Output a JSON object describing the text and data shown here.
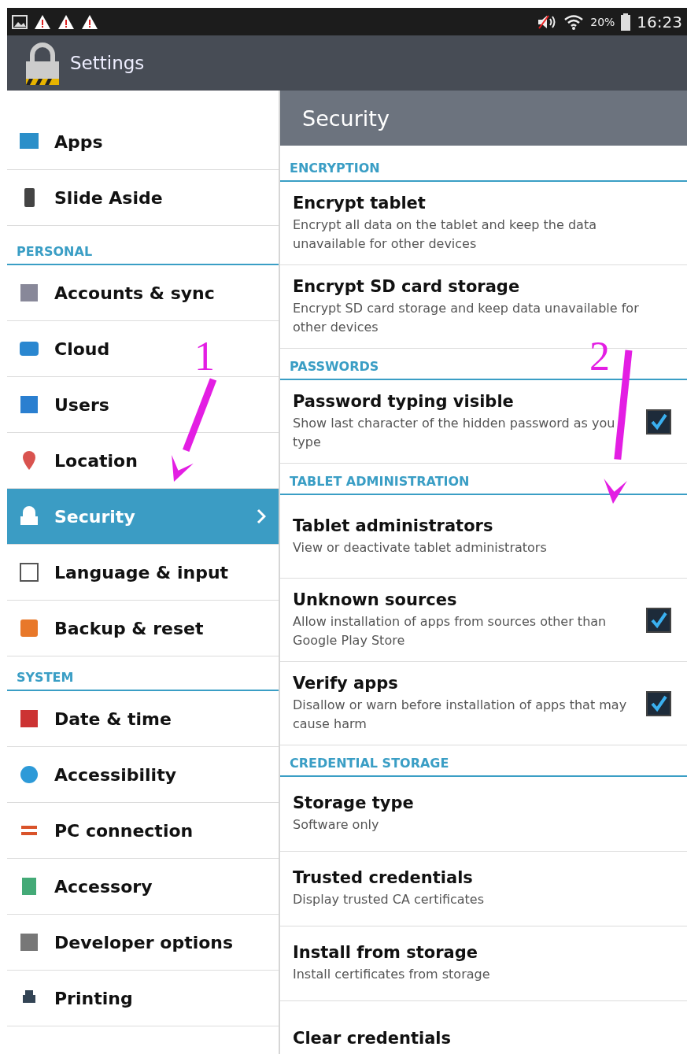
{
  "status_bar": {
    "battery": "20%",
    "time": "16:23"
  },
  "action_bar": {
    "title": "Settings"
  },
  "sidebar": {
    "groups": [
      {
        "items": [
          {
            "label": "Apps",
            "selected": false
          },
          {
            "label": "Slide Aside",
            "selected": false
          }
        ]
      },
      {
        "header": "PERSONAL",
        "items": [
          {
            "label": "Accounts & sync",
            "selected": false
          },
          {
            "label": "Cloud",
            "selected": false
          },
          {
            "label": "Users",
            "selected": false
          },
          {
            "label": "Location",
            "selected": false
          },
          {
            "label": "Security",
            "selected": true
          },
          {
            "label": "Language & input",
            "selected": false
          },
          {
            "label": "Backup & reset",
            "selected": false
          }
        ]
      },
      {
        "header": "SYSTEM",
        "items": [
          {
            "label": "Date & time",
            "selected": false
          },
          {
            "label": "Accessibility",
            "selected": false
          },
          {
            "label": "PC connection",
            "selected": false
          },
          {
            "label": "Accessory",
            "selected": false
          },
          {
            "label": "Developer options",
            "selected": false
          },
          {
            "label": "Printing",
            "selected": false
          }
        ]
      }
    ]
  },
  "detail": {
    "title": "Security",
    "sections": [
      {
        "header": "ENCRYPTION",
        "items": [
          {
            "kind": "plain",
            "title": "Encrypt tablet",
            "summary": "Encrypt all data on the tablet and keep the data unavailable for other devices"
          },
          {
            "kind": "plain",
            "title": "Encrypt SD card storage",
            "summary": "Encrypt SD card storage and keep data unavailable for other devices"
          }
        ]
      },
      {
        "header": "PASSWORDS",
        "items": [
          {
            "kind": "checkbox",
            "title": "Password typing visible",
            "summary": "Show last character of the hidden password as you type",
            "checked": true
          }
        ]
      },
      {
        "header": "TABLET ADMINISTRATION",
        "items": [
          {
            "kind": "plain",
            "title": "Tablet administrators",
            "summary": "View or deactivate tablet administrators"
          },
          {
            "kind": "checkbox",
            "title": "Unknown sources",
            "summary": "Allow installation of apps from sources other than Google Play Store",
            "checked": true
          },
          {
            "kind": "checkbox",
            "title": "Verify apps",
            "summary": "Disallow or warn before installation of apps that may cause harm",
            "checked": true
          }
        ]
      },
      {
        "header": "CREDENTIAL STORAGE",
        "items": [
          {
            "kind": "plain",
            "title": "Storage type",
            "summary": "Software only"
          },
          {
            "kind": "plain",
            "title": "Trusted credentials",
            "summary": "Display trusted CA certificates"
          },
          {
            "kind": "plain",
            "title": "Install from storage",
            "summary": "Install certificates from storage"
          },
          {
            "kind": "plain",
            "title": "Clear credentials"
          }
        ]
      }
    ]
  },
  "annotations": [
    {
      "label": "1"
    },
    {
      "label": "2"
    }
  ]
}
